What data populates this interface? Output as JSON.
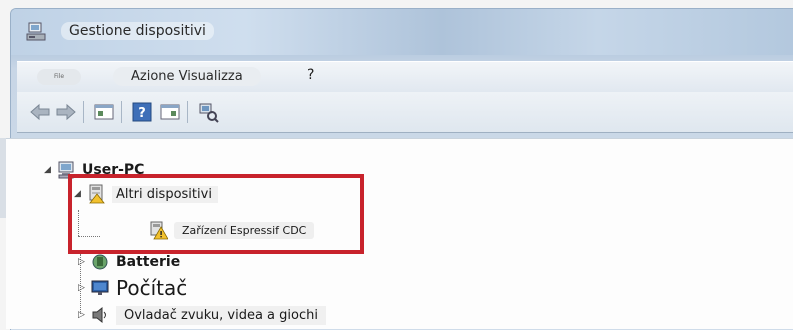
{
  "window": {
    "title": "Gestione dispositivi",
    "icon": "device-manager-icon"
  },
  "menu": {
    "file_label": "File",
    "azione_visualizza": "Azione Visualizza",
    "help_label": "?"
  },
  "toolbar": {
    "buttons": [
      "back-arrow-icon",
      "forward-arrow-icon",
      "properties-icon",
      "help-icon",
      "show-hide-pane-icon",
      "scan-hardware-icon"
    ]
  },
  "tree": {
    "root": "User-PC",
    "altri_dispositivi": "Altri dispositivi",
    "espressif": "Zařízení Espressif CDC",
    "batterie": "Batterie",
    "pocitac": "Počítač",
    "audio": "Ovladač zvuku, videa a giochi"
  },
  "colors": {
    "highlight_border": "#c8232c",
    "title_gradient": "#bfd2e6",
    "warning_yellow": "#f2c12e"
  }
}
